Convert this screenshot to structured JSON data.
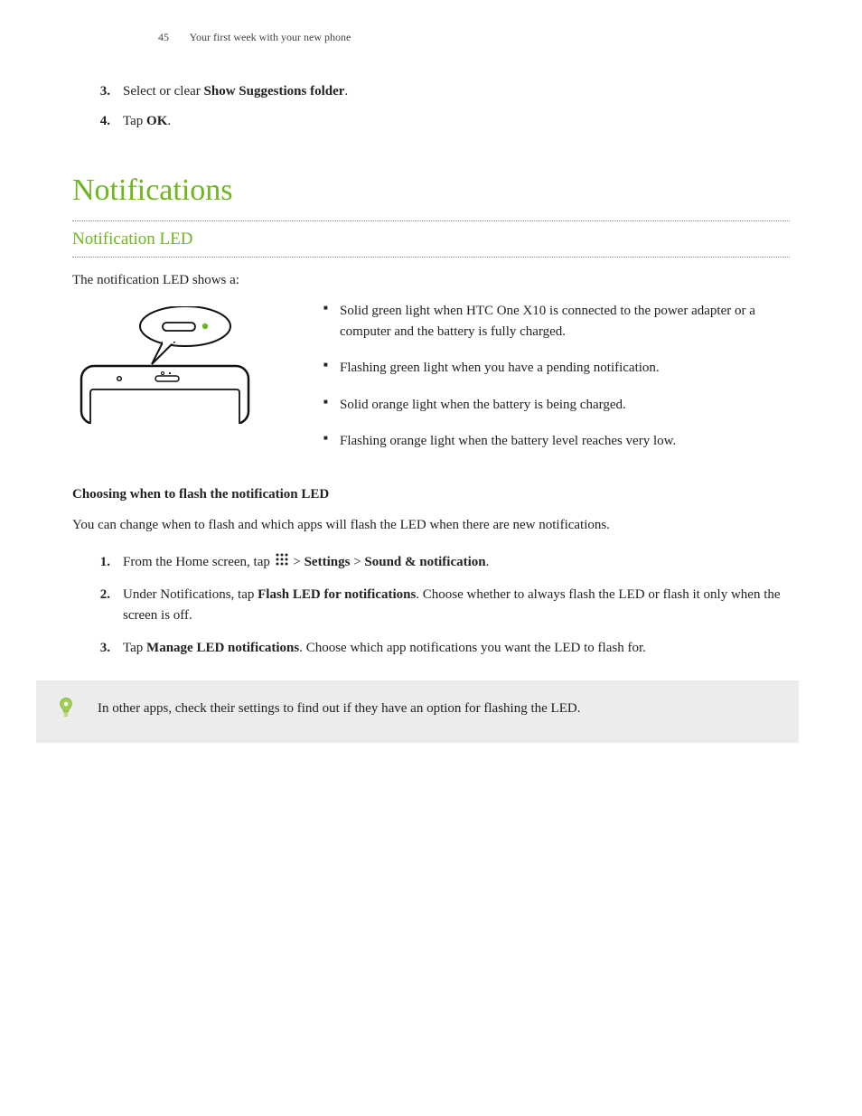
{
  "header": {
    "page_number": "45",
    "chapter": "Your first week with your new phone"
  },
  "top_steps": [
    {
      "num": "3.",
      "prefix": "Select or clear ",
      "bold": "Show Suggestions folder",
      "suffix": "."
    },
    {
      "num": "4.",
      "prefix": "Tap ",
      "bold": "OK",
      "suffix": "."
    }
  ],
  "section_title": "Notifications",
  "subsection_title": "Notification LED",
  "intro": "The notification LED shows a:",
  "led_items": [
    "Solid green light when HTC One X10 is connected to the power adapter or a computer and the battery is fully charged.",
    "Flashing green light when you have a pending notification.",
    "Solid orange light when the battery is being charged.",
    "Flashing orange light when the battery level reaches very low."
  ],
  "choosing_heading": "Choosing when to flash the notification LED",
  "choosing_intro": "You can change when to flash and which apps will flash the LED when there are new notifications.",
  "steps": [
    {
      "num": "1.",
      "segments": [
        {
          "t": "From the Home screen, tap "
        },
        {
          "icon": "apps"
        },
        {
          "t": " > "
        },
        {
          "b": "Settings"
        },
        {
          "t": " > "
        },
        {
          "b": "Sound & notification"
        },
        {
          "t": "."
        }
      ]
    },
    {
      "num": "2.",
      "segments": [
        {
          "t": "Under Notifications, tap "
        },
        {
          "b": "Flash LED for notifications"
        },
        {
          "t": ". Choose whether to always flash the LED or flash it only when the screen is off."
        }
      ]
    },
    {
      "num": "3.",
      "segments": [
        {
          "t": "Tap "
        },
        {
          "b": "Manage LED notifications"
        },
        {
          "t": ". Choose which app notifications you want the LED to flash for."
        }
      ]
    }
  ],
  "tip_text": "In other apps, check their settings to find out if they have an option for flashing the LED."
}
